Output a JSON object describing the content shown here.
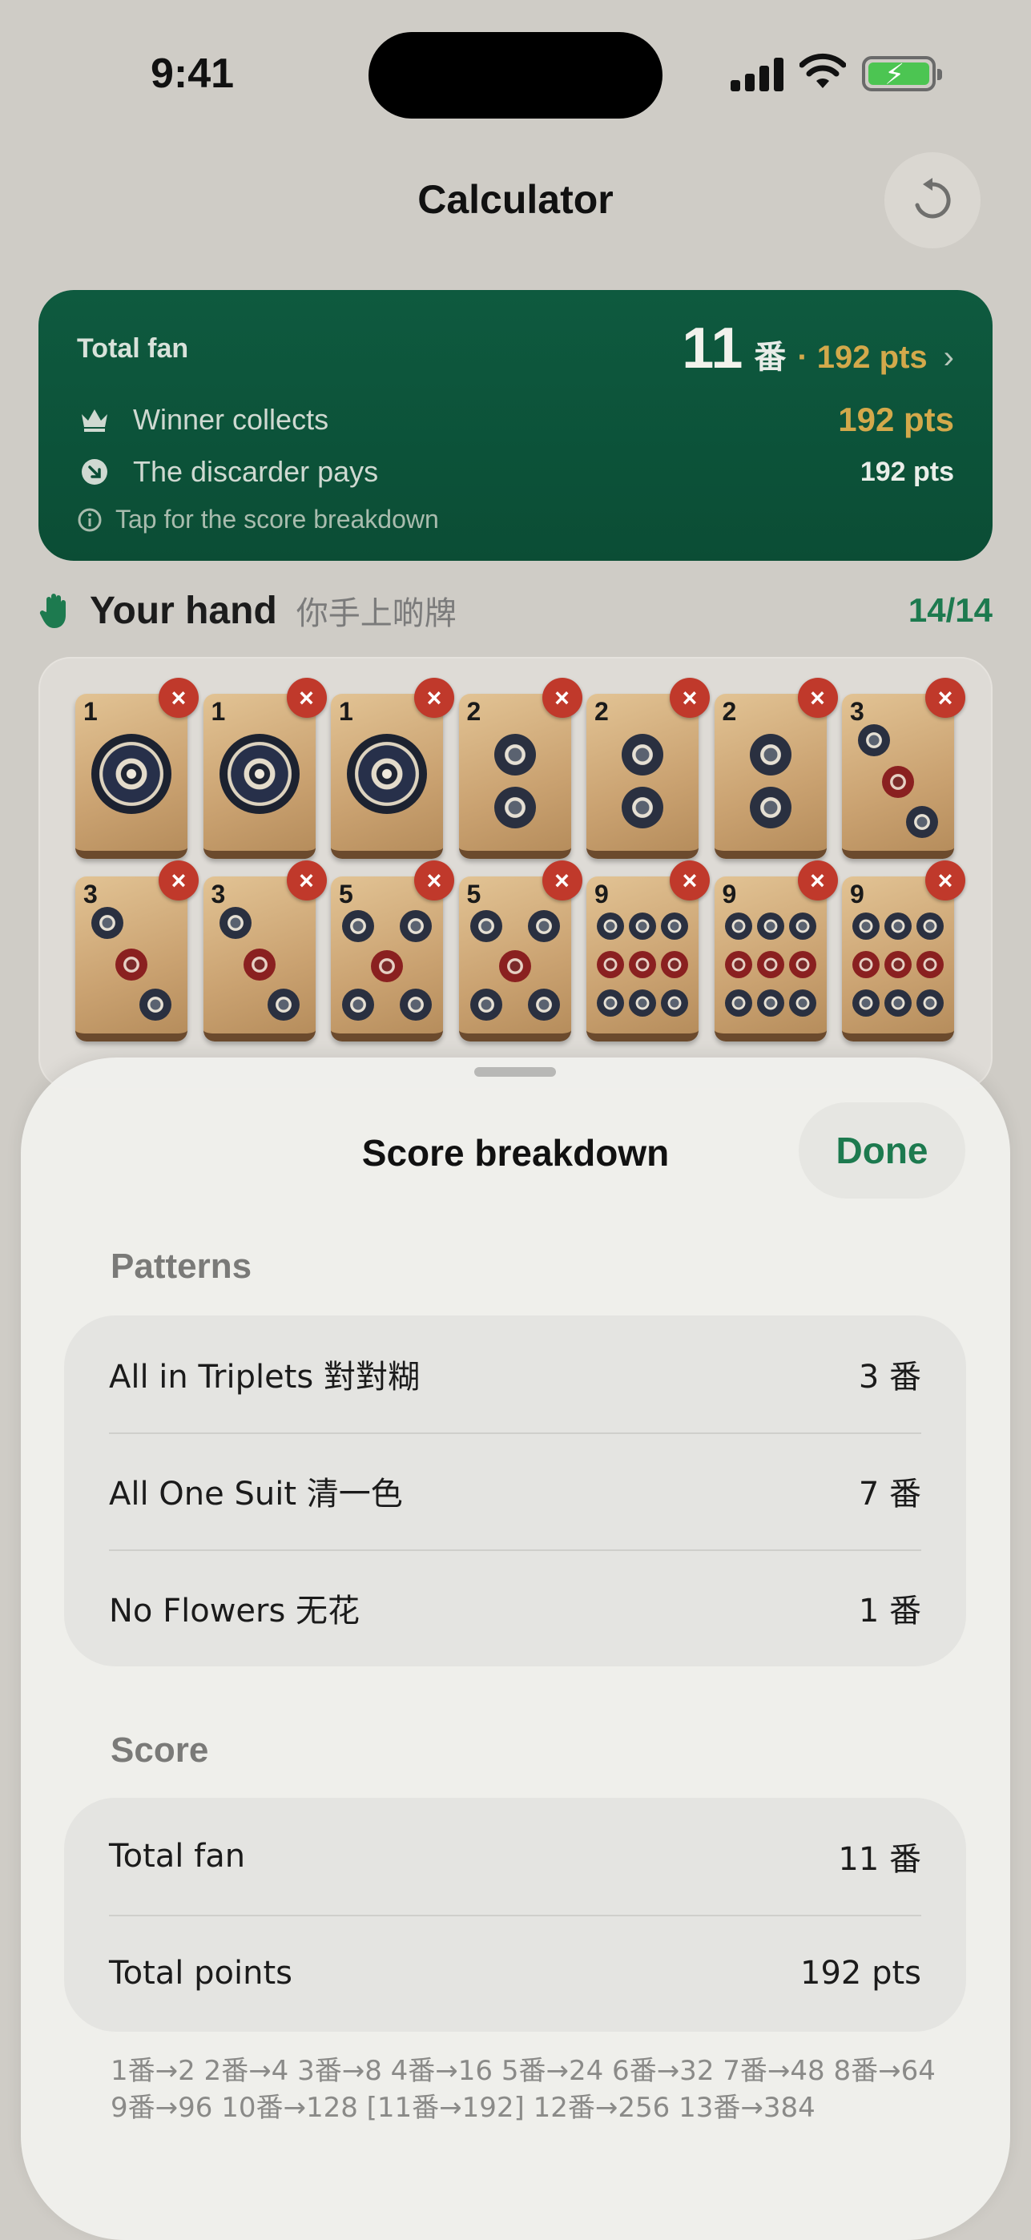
{
  "status_bar": {
    "time": "9:41"
  },
  "header": {
    "title": "Calculator"
  },
  "total_card": {
    "label": "Total fan",
    "fan_number": "11",
    "fan_unit": "番",
    "points_text": "· 192 pts",
    "winner_label": "Winner collects",
    "winner_value": "192 pts",
    "discarder_label": "The discarder pays",
    "discarder_value": "192 pts",
    "hint": "Tap for the score breakdown"
  },
  "hand": {
    "title": "Your hand",
    "subtitle": "你手上啲牌",
    "count": "14/14",
    "tiles": [
      {
        "rank": "1",
        "suit": "dots"
      },
      {
        "rank": "1",
        "suit": "dots"
      },
      {
        "rank": "1",
        "suit": "dots"
      },
      {
        "rank": "2",
        "suit": "dots"
      },
      {
        "rank": "2",
        "suit": "dots"
      },
      {
        "rank": "2",
        "suit": "dots"
      },
      {
        "rank": "3",
        "suit": "dots"
      },
      {
        "rank": "3",
        "suit": "dots"
      },
      {
        "rank": "3",
        "suit": "dots"
      },
      {
        "rank": "5",
        "suit": "dots"
      },
      {
        "rank": "5",
        "suit": "dots"
      },
      {
        "rank": "9",
        "suit": "dots"
      },
      {
        "rank": "9",
        "suit": "dots"
      },
      {
        "rank": "9",
        "suit": "dots"
      }
    ]
  },
  "sheet": {
    "title": "Score breakdown",
    "done_label": "Done",
    "patterns_label": "Patterns",
    "patterns": [
      {
        "name": "All in Triplets 對對糊",
        "fan": "3 番"
      },
      {
        "name": "All One Suit 清一色",
        "fan": "7 番"
      },
      {
        "name": "No Flowers 无花",
        "fan": "1 番"
      }
    ],
    "score_label": "Score",
    "score_rows": [
      {
        "name": "Total fan",
        "value": "11 番"
      },
      {
        "name": "Total points",
        "value": "192 pts"
      }
    ],
    "scale_text": "1番→2   2番→4   3番→8   4番→16   5番→24   6番→32   7番→48   8番→64   9番→96   10番→128   [11番→192]   12番→256   13番→384"
  },
  "colors": {
    "accent_green": "#1d7a4f",
    "card_green": "#0e5a3f",
    "gold": "#d3a94b",
    "remove_red": "#c0392b"
  }
}
